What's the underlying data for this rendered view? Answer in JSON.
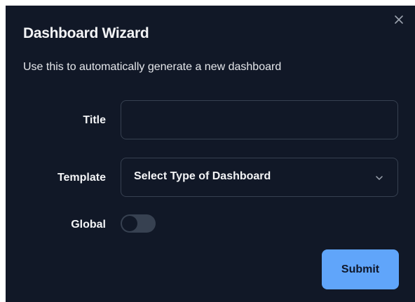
{
  "dialog": {
    "title": "Dashboard Wizard",
    "description": "Use this to automatically generate a new dashboard",
    "close_icon": "close-icon"
  },
  "form": {
    "title_label": "Title",
    "title_value": "",
    "template_label": "Template",
    "template_selected": "Select Type of Dashboard",
    "template_icon": "chevron-down-icon",
    "global_label": "Global",
    "global_enabled": false
  },
  "actions": {
    "submit_label": "Submit"
  },
  "colors": {
    "background": "#111827",
    "border": "#374151",
    "accent": "#60a5fa",
    "text": "#f3f4f6"
  }
}
